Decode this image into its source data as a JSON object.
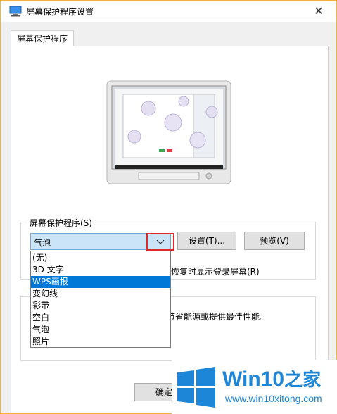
{
  "window": {
    "title": "屏幕保护程序设置",
    "close": "✕"
  },
  "tabs": [
    {
      "label": "屏幕保护程序"
    }
  ],
  "screensaver_group": {
    "label": "屏幕保护程序(S)",
    "selected": "气泡",
    "settings_button": "设置(T)...",
    "preview_button": "预览(V)",
    "options": [
      "(无)",
      "3D 文字",
      "WPS画报",
      "变幻线",
      "彩带",
      "空白",
      "气泡",
      "照片"
    ],
    "highlighted_index": 2
  },
  "partial_text": {
    "resume": "恢复时显示登录屏幕(R)",
    "power": "节省能源或提供最佳性能。"
  },
  "ok_button": "确定",
  "watermark": {
    "brand": "Win10",
    "brand_cn": "之家",
    "url": "www.win10xitong.com"
  },
  "colors": {
    "accent": "#0078d7",
    "brand": "#1e86d6",
    "highlight_border": "#e02828"
  }
}
